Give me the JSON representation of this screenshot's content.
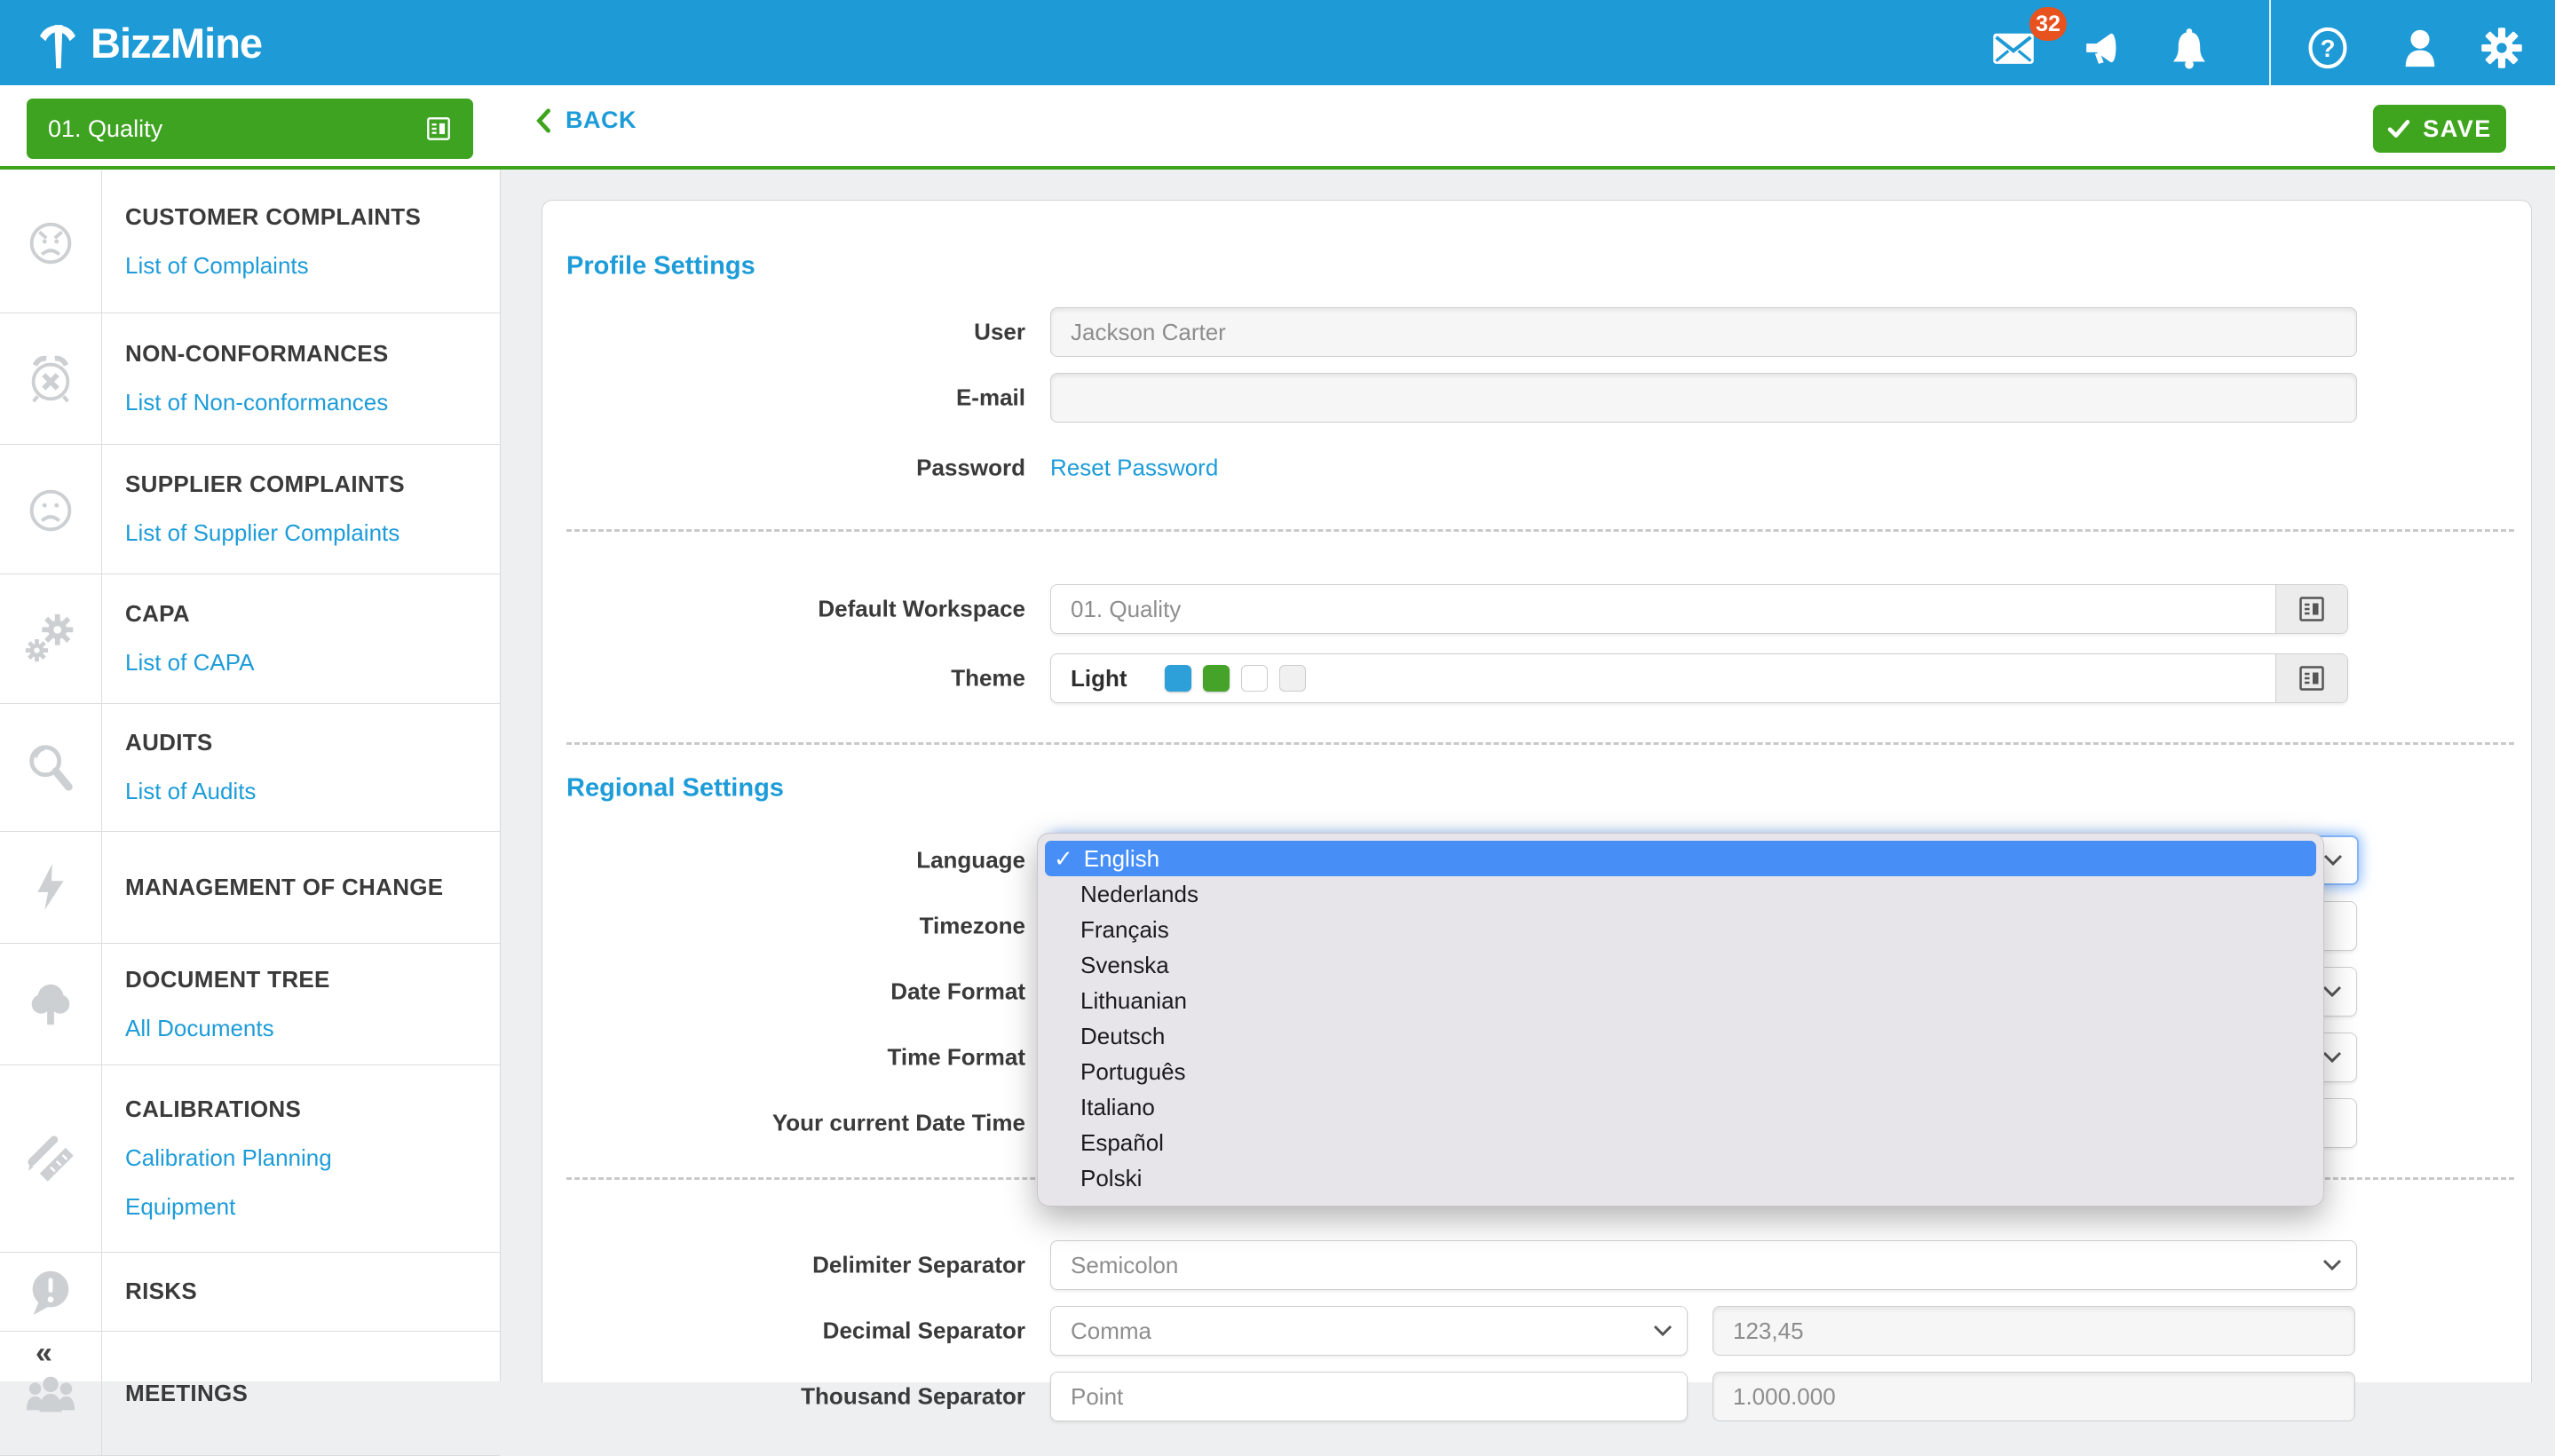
{
  "topbar": {
    "brand": "BizzMine",
    "mail_badge": "32",
    "icons": [
      "mail-icon",
      "megaphone-icon",
      "bell-icon",
      "help-icon",
      "user-icon",
      "gear-icon"
    ]
  },
  "sidebar": {
    "workspace_button": "01. Quality",
    "sections": [
      {
        "icon": "angry-face-icon",
        "title": "CUSTOMER COMPLAINTS",
        "links": [
          "List of Complaints"
        ]
      },
      {
        "icon": "alarm-x-icon",
        "title": "NON-CONFORMANCES",
        "links": [
          "List of Non-conformances"
        ]
      },
      {
        "icon": "sad-face-icon",
        "title": "SUPPLIER COMPLAINTS",
        "links": [
          "List of Supplier Complaints"
        ]
      },
      {
        "icon": "gears-icon",
        "title": "CAPA",
        "links": [
          "List of CAPA"
        ]
      },
      {
        "icon": "magnifier-icon",
        "title": "AUDITS",
        "links": [
          "List of Audits"
        ]
      },
      {
        "icon": "lightning-icon",
        "title": "MANAGEMENT OF CHANGE",
        "links": []
      },
      {
        "icon": "tree-icon",
        "title": "DOCUMENT TREE",
        "links": [
          "All Documents"
        ]
      },
      {
        "icon": "ruler-pencil-icon",
        "title": "CALIBRATIONS",
        "links": [
          "Calibration Planning",
          "Equipment"
        ]
      },
      {
        "icon": "chat-exclamation-icon",
        "title": "RISKS",
        "links": []
      },
      {
        "icon": "people-icon",
        "title": "MEETINGS",
        "links": [],
        "collapse_marker": "«"
      }
    ]
  },
  "header": {
    "back_label": "BACK",
    "save_label": "SAVE"
  },
  "form": {
    "profile_heading": "Profile Settings",
    "regional_heading": "Regional Settings",
    "user": {
      "label": "User",
      "value": "Jackson Carter"
    },
    "email": {
      "label": "E-mail",
      "value": ""
    },
    "password": {
      "label": "Password",
      "link": "Reset Password"
    },
    "workspace": {
      "label": "Default Workspace",
      "value": "01. Quality"
    },
    "theme": {
      "label": "Theme",
      "value": "Light",
      "swatches": [
        "#2D9FD9",
        "#46A32A",
        "#FFFFFF",
        "#F0F0F0"
      ]
    },
    "language": {
      "label": "Language"
    },
    "timezone": {
      "label": "Timezone"
    },
    "date_format": {
      "label": "Date Format"
    },
    "time_format": {
      "label": "Time Format"
    },
    "current_datetime": {
      "label": "Your current Date Time"
    },
    "delimiter": {
      "label": "Delimiter Separator",
      "value": "Semicolon"
    },
    "decimal": {
      "label": "Decimal Separator",
      "value": "Comma",
      "example": "123,45"
    },
    "thousand": {
      "label": "Thousand Separator",
      "value": "Point",
      "example": "1.000.000"
    }
  },
  "language_dropdown": {
    "selected": "English",
    "options": [
      "English",
      "Nederlands",
      "Français",
      "Svenska",
      "Lithuanian",
      "Deutsch",
      "Português",
      "Italiano",
      "Español",
      "Polski"
    ]
  },
  "colors": {
    "topbar_blue": "#1E9AD6",
    "accent_blue": "#1D9CD8",
    "green": "#3EA321",
    "badge_orange": "#E8521F",
    "dropdown_highlight": "#478FF6"
  }
}
